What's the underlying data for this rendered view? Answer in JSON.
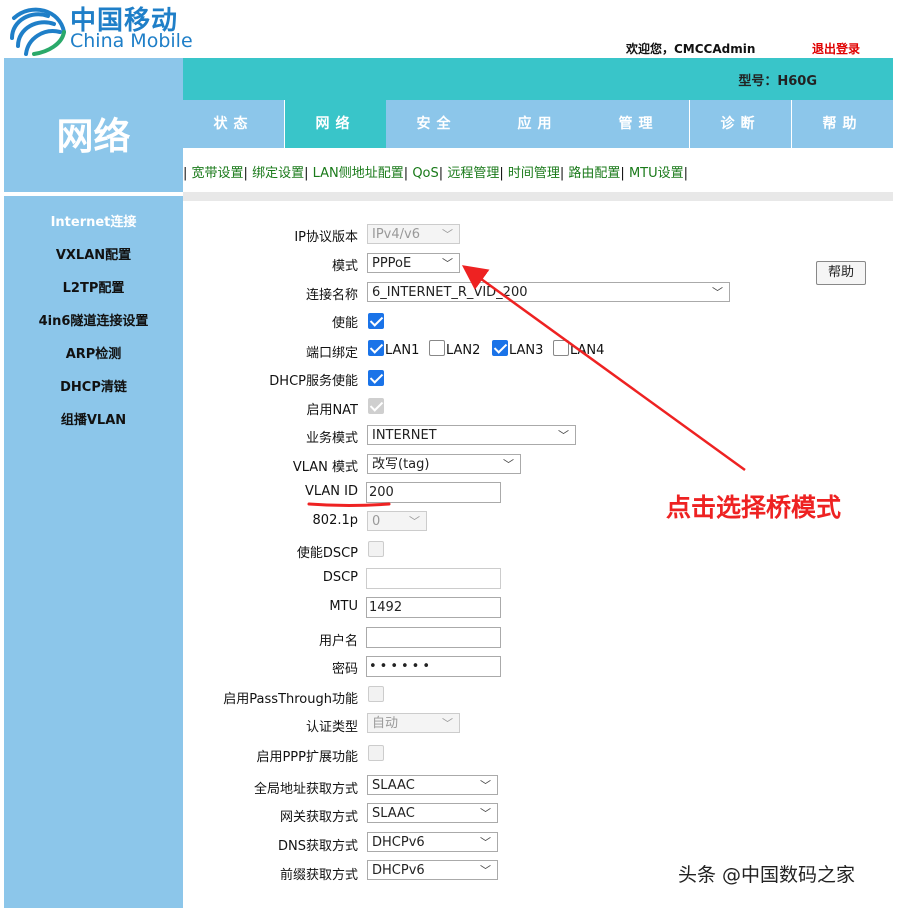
{
  "brand": {
    "cn": "中国移动",
    "en": "China Mobile"
  },
  "header": {
    "welcome": "欢迎您，CMCCAdmin",
    "logout": "退出登录",
    "model": "型号：H60G"
  },
  "left_title": "网络",
  "nav": {
    "tabs": [
      "状态",
      "网络",
      "安全",
      "应用",
      "管理",
      "诊断",
      "帮助"
    ],
    "active_index": 1
  },
  "subnav": {
    "items": [
      "宽带设置",
      "绑定设置",
      "LAN侧地址配置",
      "QoS",
      "远程管理",
      "时间管理",
      "路由配置",
      "MTU设置"
    ]
  },
  "sidebar": {
    "items": [
      "Internet连接",
      "VXLAN配置",
      "L2TP配置",
      "4in6隧道连接设置",
      "ARP检测",
      "DHCP清链",
      "组播VLAN"
    ],
    "active_index": 0
  },
  "form": {
    "ip_version": {
      "label": "IP协议版本",
      "value": "IPv4/v6"
    },
    "mode": {
      "label": "模式",
      "value": "PPPoE"
    },
    "conn_name": {
      "label": "连接名称",
      "value": "6_INTERNET_R_VID_200"
    },
    "enable": {
      "label": "使能"
    },
    "port_bind": {
      "label": "端口绑定",
      "ports": [
        "LAN1",
        "LAN2",
        "LAN3",
        "LAN4"
      ],
      "checked": [
        true,
        false,
        true,
        false
      ]
    },
    "dhcp_enable": {
      "label": "DHCP服务使能"
    },
    "nat": {
      "label": "启用NAT"
    },
    "service_mode": {
      "label": "业务模式",
      "value": "INTERNET"
    },
    "vlan_mode": {
      "label": "VLAN 模式",
      "value": "改写(tag)"
    },
    "vlan_id": {
      "label": "VLAN ID",
      "value": "200"
    },
    "dot1p": {
      "label": "802.1p",
      "value": "0"
    },
    "dscp_enable": {
      "label": "使能DSCP"
    },
    "dscp": {
      "label": "DSCP",
      "value": ""
    },
    "mtu": {
      "label": "MTU",
      "value": "1492"
    },
    "username": {
      "label": "用户名",
      "value": ""
    },
    "password": {
      "label": "密码",
      "value": "••••••"
    },
    "passthrough": {
      "label": "启用PassThrough功能"
    },
    "auth_type": {
      "label": "认证类型",
      "value": "自动"
    },
    "ppp_ext": {
      "label": "启用PPP扩展功能"
    },
    "global_addr": {
      "label": "全局地址获取方式",
      "value": "SLAAC"
    },
    "gateway": {
      "label": "网关获取方式",
      "value": "SLAAC"
    },
    "dns": {
      "label": "DNS获取方式",
      "value": "DHCPv6"
    },
    "prefix": {
      "label": "前缀获取方式",
      "value": "DHCPv6"
    }
  },
  "help_button": "帮助",
  "annotation": "点击选择桥模式",
  "watermark": "头条 @中国数码之家",
  "colors": {
    "teal": "#39c5c9",
    "sky": "#8cc6ea",
    "brand": "#1f7fc8",
    "annotation": "#e22222"
  }
}
